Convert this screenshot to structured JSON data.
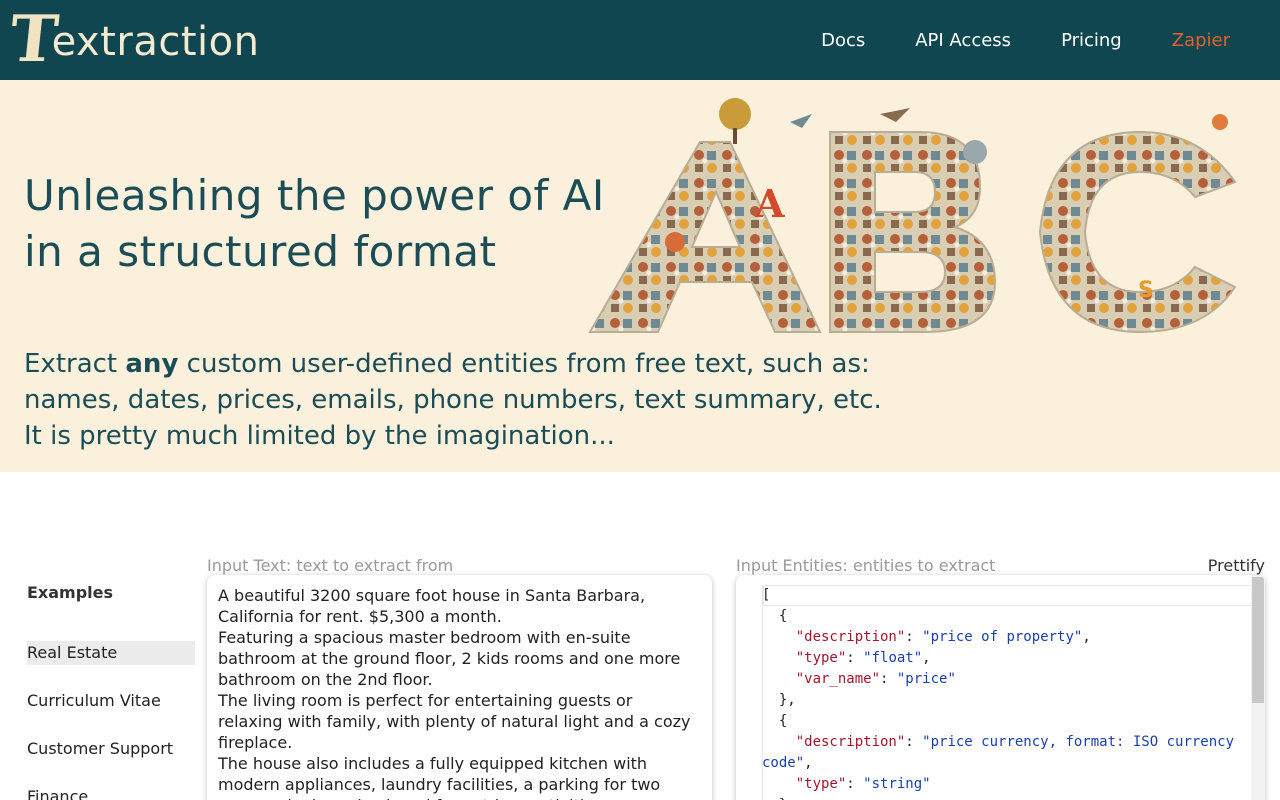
{
  "nav": {
    "logo_initial": "T",
    "logo_rest": "extraction",
    "links": [
      {
        "label": "Docs"
      },
      {
        "label": "API Access"
      },
      {
        "label": "Pricing"
      },
      {
        "label": "Zapier"
      }
    ]
  },
  "hero": {
    "title_line1": "Unleashing the power of AI",
    "title_line2": "in a structured format",
    "sub_line1_pre": "Extract ",
    "sub_line1_bold": "any",
    "sub_line1_post": " custom user-defined entities from free text, such as:",
    "sub_line2": "names, dates, prices, emails, phone numbers, text summary, etc.",
    "sub_line3": "It is pretty much limited by the imagination...",
    "art_letters": [
      "A",
      "B",
      "C"
    ]
  },
  "examples": {
    "title": "Examples",
    "items": [
      {
        "label": "Real Estate",
        "active": true
      },
      {
        "label": "Curriculum Vitae",
        "active": false
      },
      {
        "label": "Customer Support",
        "active": false
      },
      {
        "label": "Finance",
        "active": false
      }
    ]
  },
  "input_text": {
    "label": "Input Text: text to extract from",
    "value": "A beautiful 3200 square foot house in Santa Barbara, California for rent. $5,300 a month.\nFeaturing a spacious master bedroom with en-suite bathroom at the ground floor, 2 kids rooms and one more bathroom on the 2nd floor.\nThe living room is perfect for entertaining guests or relaxing with family, with plenty of natural light and a cozy fireplace.\nThe house also includes a fully equipped kitchen with modern appliances, laundry facilities, a parking for two cars, and a large backyard for outdoor activities."
  },
  "input_entities": {
    "label": "Input Entities: entities to extract",
    "prettify_label": "Prettify",
    "entities": [
      {
        "description": "price of property",
        "type": "float",
        "var_name": "price"
      },
      {
        "description": "price currency, format: ISO currency code",
        "type": "string"
      }
    ]
  },
  "colors": {
    "nav_bg": "#0f4650",
    "hero_bg": "#faf0dc",
    "title_color": "#1b4d57",
    "accent": "#e0612d",
    "json_key": "#a3152a",
    "json_string": "#1a3fa8"
  }
}
